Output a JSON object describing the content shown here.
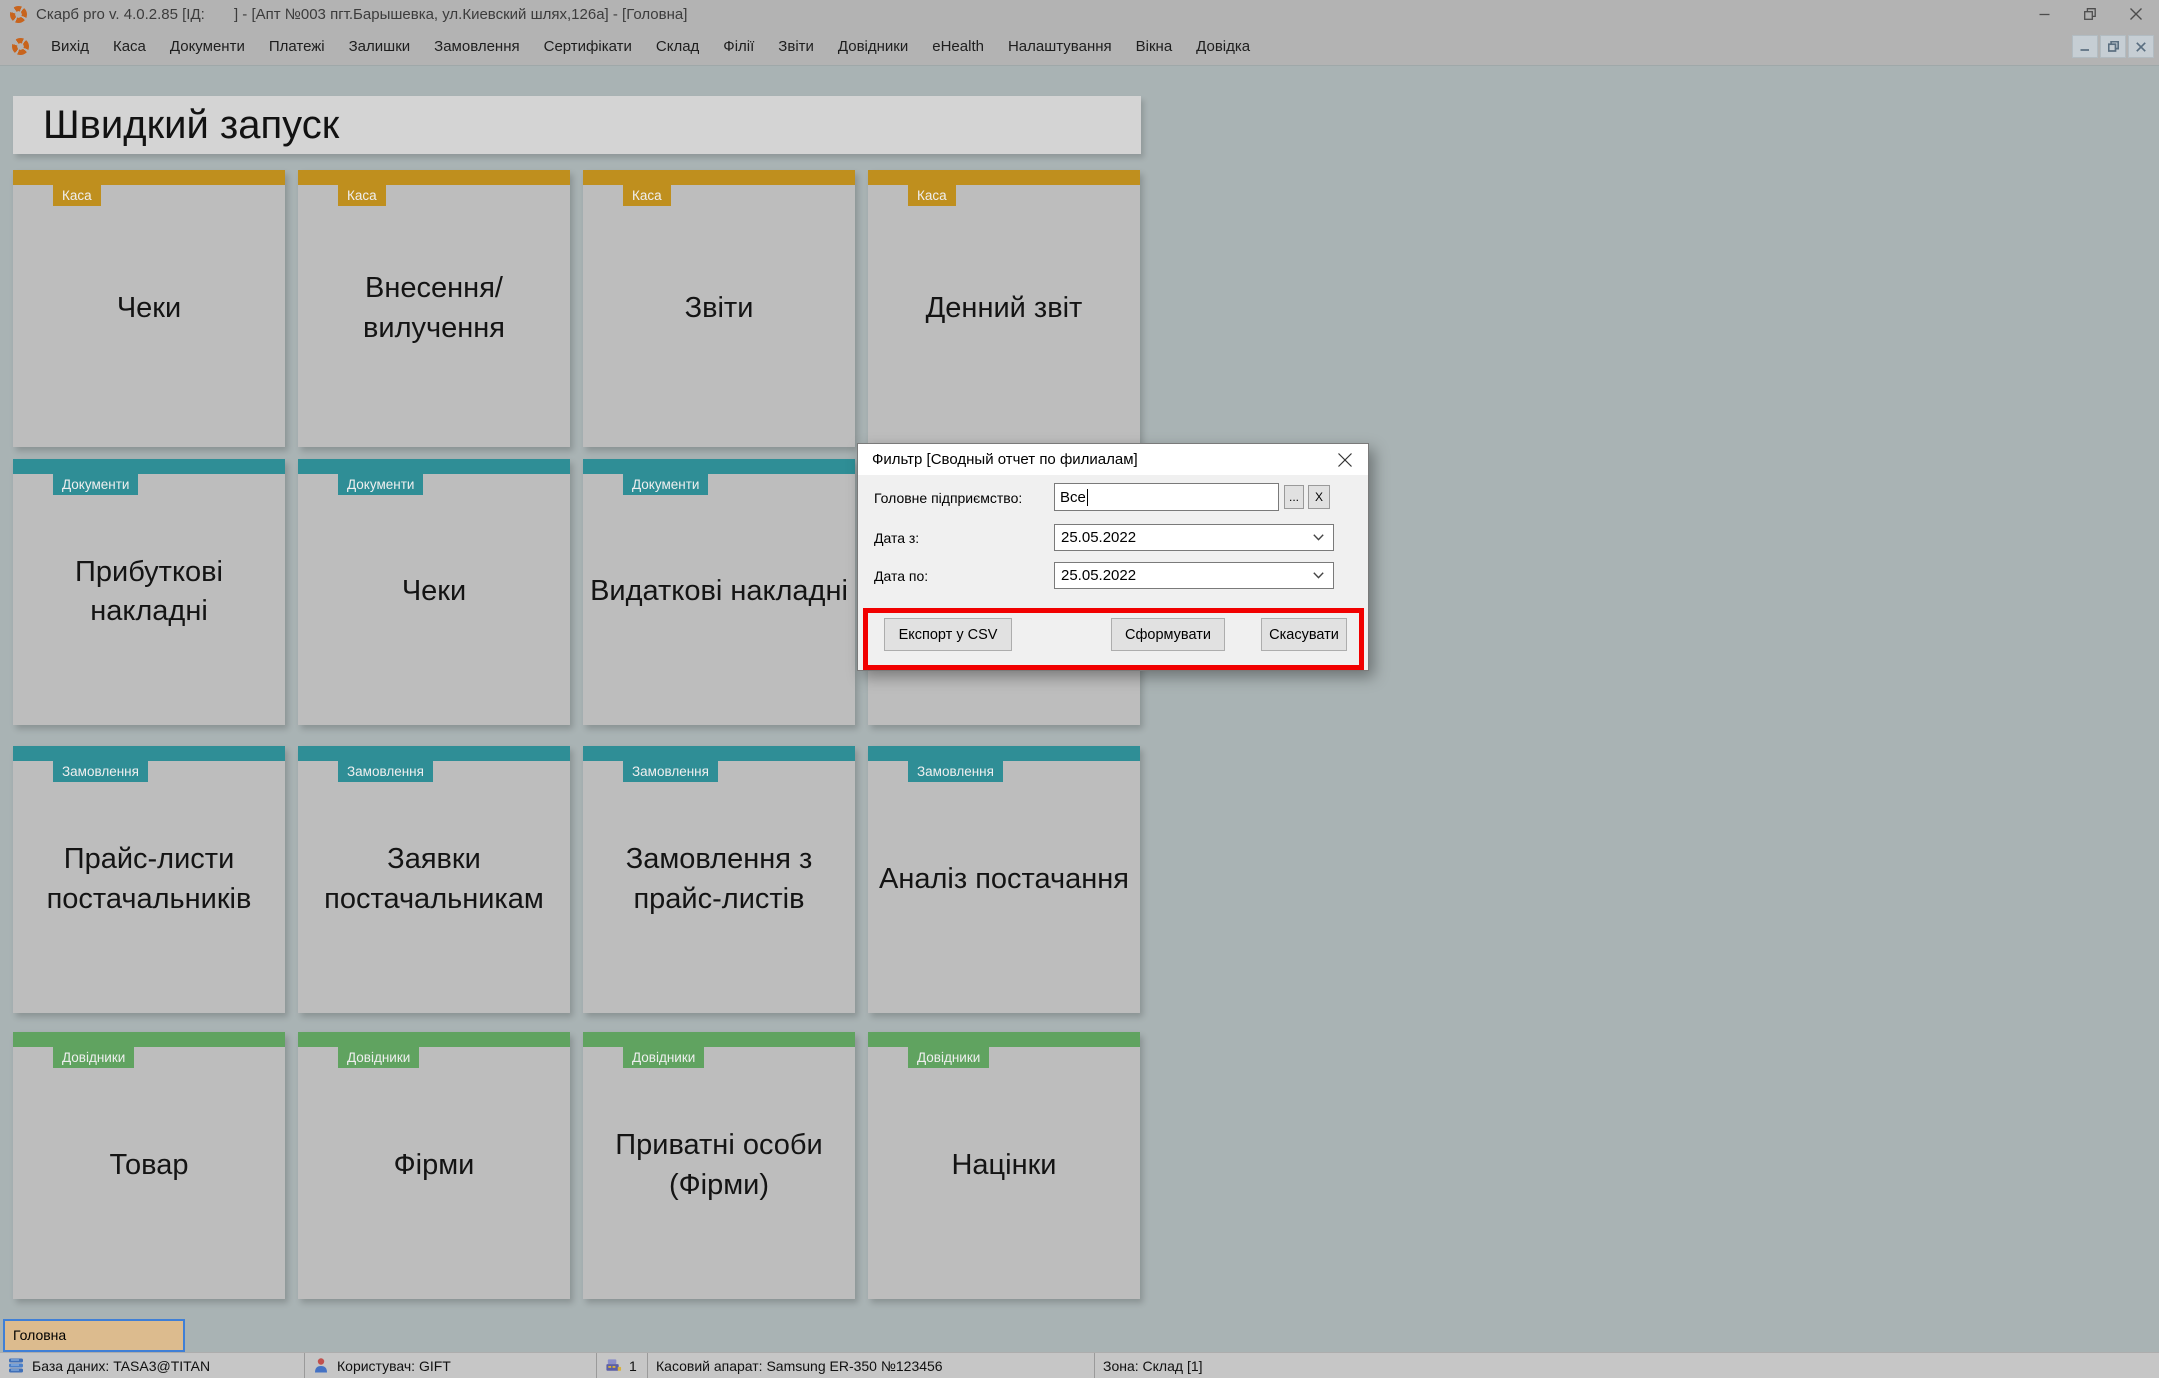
{
  "window": {
    "title": "Скарб pro v. 4.0.2.85 [ІД:       ] - [Апт №003 пгт.Барышевка, ул.Киевский шлях,126а] - [Головна]"
  },
  "menu": {
    "items": [
      "Вихід",
      "Каса",
      "Документи",
      "Платежі",
      "Залишки",
      "Замовлення",
      "Сертифікати",
      "Склад",
      "Філії",
      "Звіти",
      "Довідники",
      "eHealth",
      "Налаштування",
      "Вікна",
      "Довідка"
    ]
  },
  "quick_launch": {
    "title": "Швидкий запуск",
    "tiles": [
      {
        "row": 0,
        "col": 0,
        "category": "Каса",
        "color": "gold",
        "label": "Чеки"
      },
      {
        "row": 0,
        "col": 1,
        "category": "Каса",
        "color": "gold",
        "label": "Внесення/вилучення"
      },
      {
        "row": 0,
        "col": 2,
        "category": "Каса",
        "color": "gold",
        "label": "Звіти"
      },
      {
        "row": 0,
        "col": 3,
        "category": "Каса",
        "color": "gold",
        "label": "Денний звіт"
      },
      {
        "row": 1,
        "col": 0,
        "category": "Документи",
        "color": "teal",
        "label": "Прибуткові накладні"
      },
      {
        "row": 1,
        "col": 1,
        "category": "Документи",
        "color": "teal",
        "label": "Чеки"
      },
      {
        "row": 1,
        "col": 2,
        "category": "Документи",
        "color": "teal",
        "label": "Видаткові накладні"
      },
      {
        "row": 1,
        "col": 3,
        "category": "",
        "color": "",
        "label": ""
      },
      {
        "row": 2,
        "col": 0,
        "category": "Замовлення",
        "color": "teal",
        "label": "Прайс-листи постачальників"
      },
      {
        "row": 2,
        "col": 1,
        "category": "Замовлення",
        "color": "teal",
        "label": "Заявки постачальникам"
      },
      {
        "row": 2,
        "col": 2,
        "category": "Замовлення",
        "color": "teal",
        "label": "Замовлення з прайс-листів"
      },
      {
        "row": 2,
        "col": 3,
        "category": "Замовлення",
        "color": "teal",
        "label": "Аналіз постачання"
      },
      {
        "row": 3,
        "col": 0,
        "category": "Довідники",
        "color": "green",
        "label": "Товар"
      },
      {
        "row": 3,
        "col": 1,
        "category": "Довідники",
        "color": "green",
        "label": "Фірми"
      },
      {
        "row": 3,
        "col": 2,
        "category": "Довідники",
        "color": "green",
        "label": "Приватні особи (Фірми)"
      },
      {
        "row": 3,
        "col": 3,
        "category": "Довідники",
        "color": "green",
        "label": "Націнки"
      }
    ]
  },
  "dialog": {
    "title": "Фильтр [Сводный отчет по филиалам]",
    "fields": [
      {
        "label": "Головне підприємство:",
        "value": "Все"
      },
      {
        "label": "Дата з:",
        "value": "25.05.2022"
      },
      {
        "label": "Дата по:",
        "value": "25.05.2022"
      }
    ],
    "browse_label": "...",
    "clear_label": "X",
    "buttons": [
      "Експорт у CSV",
      "Сформувати",
      "Скасувати"
    ]
  },
  "tab_label": "Головна",
  "statusbar": [
    {
      "icon": "database-icon",
      "text": "База даних: TASA3@TITAN"
    },
    {
      "icon": "user-icon",
      "text": "Користувач: GIFT"
    },
    {
      "icon": "cash-register-icon",
      "text": "1"
    },
    {
      "icon": "",
      "text": "Касовий апарат: Samsung ER-350 №123456"
    },
    {
      "icon": "",
      "text": "Зона: Склад [1]"
    }
  ],
  "colors": {
    "gold": "#bf8f1e",
    "teal": "#2f8e96",
    "green": "#60a360",
    "annotation_red": "#f10000",
    "background": "#a9b3b4"
  }
}
